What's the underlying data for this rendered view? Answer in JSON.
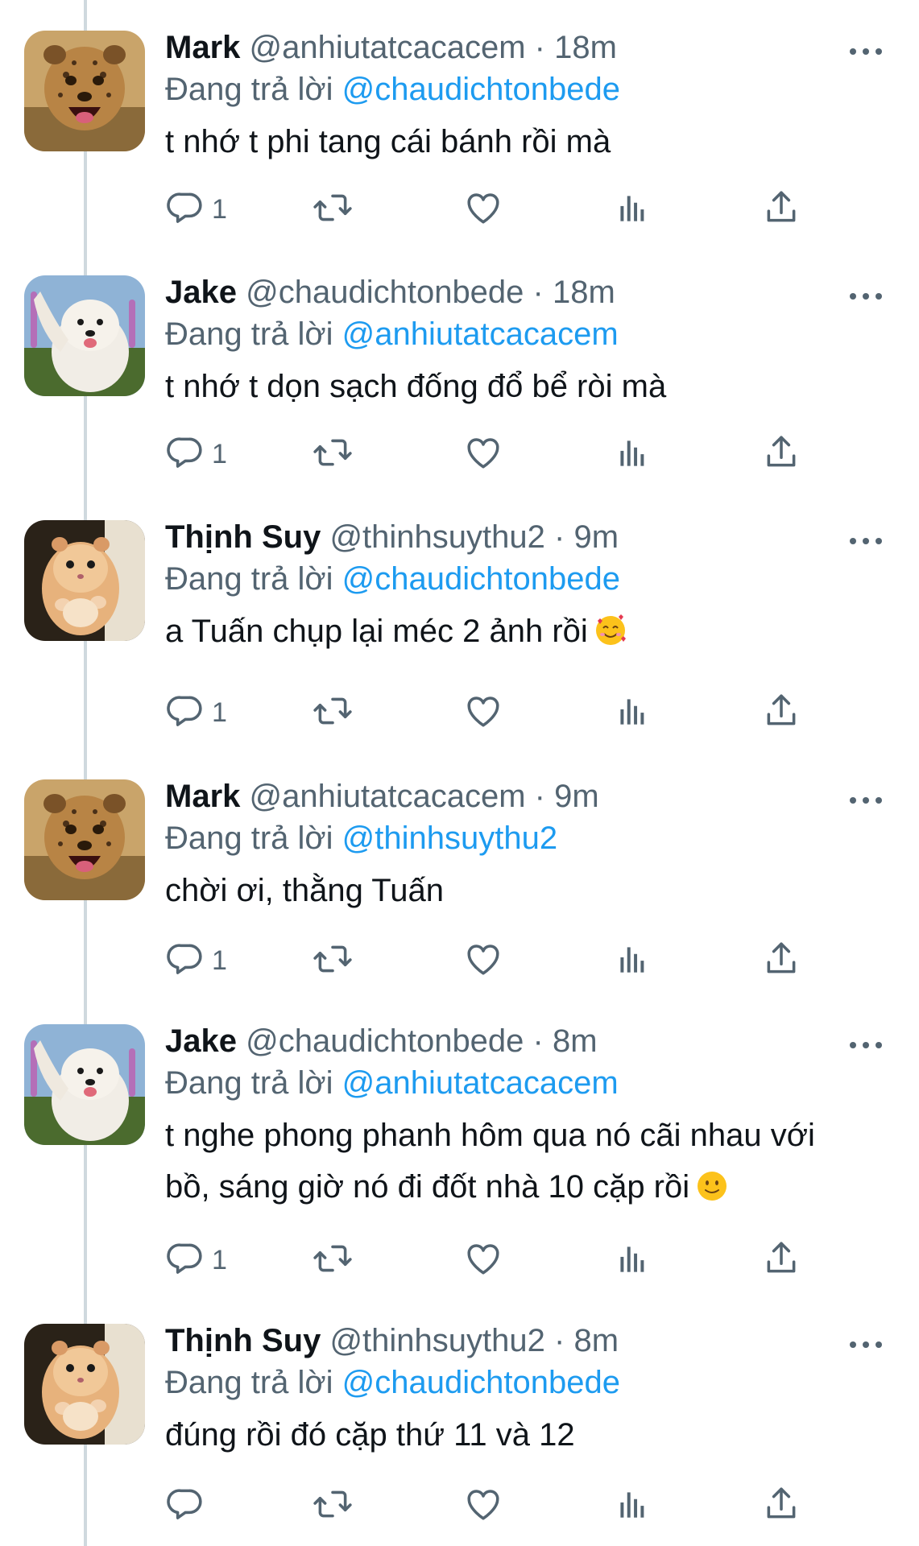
{
  "colors": {
    "accent": "#1d9bf0",
    "muted": "#536471",
    "text": "#0f1419",
    "thread_line": "#cfd9de"
  },
  "replying_prefix": "Đang trả lời",
  "tweets": [
    {
      "name": "Mark",
      "handle": "@anhiutatcacacem",
      "time": "· 18m",
      "reply_to": "@chaudichtonbede",
      "lines": [
        "t nhớ t phi tang cái bánh rồi mà"
      ],
      "reply_count": "1",
      "avatar": "cheetah-cub",
      "emoji": ""
    },
    {
      "name": "Jake",
      "handle": "@chaudichtonbede",
      "time": "· 18m",
      "reply_to": "@anhiutatcacacem",
      "lines": [
        "t nhớ t dọn sạch đống đổ bể ròi mà"
      ],
      "reply_count": "1",
      "avatar": "white-dog",
      "emoji": ""
    },
    {
      "name": "Thịnh Suy",
      "handle": "@thinhsuythu2",
      "time": "· 9m",
      "reply_to": "@chaudichtonbede",
      "lines": [
        "a Tuấn chụp lại méc 2 ảnh rồi"
      ],
      "reply_count": "1",
      "avatar": "hamster",
      "emoji": "smiling-face-with-hearts"
    },
    {
      "name": "Mark",
      "handle": "@anhiutatcacacem",
      "time": "· 9m",
      "reply_to": "@thinhsuythu2",
      "lines": [
        "chời ơi, thằng Tuấn"
      ],
      "reply_count": "1",
      "avatar": "cheetah-cub",
      "emoji": ""
    },
    {
      "name": "Jake",
      "handle": "@chaudichtonbede",
      "time": "· 8m",
      "reply_to": "@anhiutatcacacem",
      "lines": [
        "t nghe phong phanh hôm qua nó cãi nhau với",
        "bồ, sáng giờ nó đi đốt nhà 10 cặp rồi"
      ],
      "reply_count": "1",
      "avatar": "white-dog",
      "emoji": "slightly-smiling-face"
    },
    {
      "name": "Thịnh Suy",
      "handle": "@thinhsuythu2",
      "time": "· 8m",
      "reply_to": "@chaudichtonbede",
      "lines": [
        "đúng rồi đó cặp thứ 11 và 12"
      ],
      "reply_count": "",
      "avatar": "hamster",
      "emoji": ""
    }
  ]
}
